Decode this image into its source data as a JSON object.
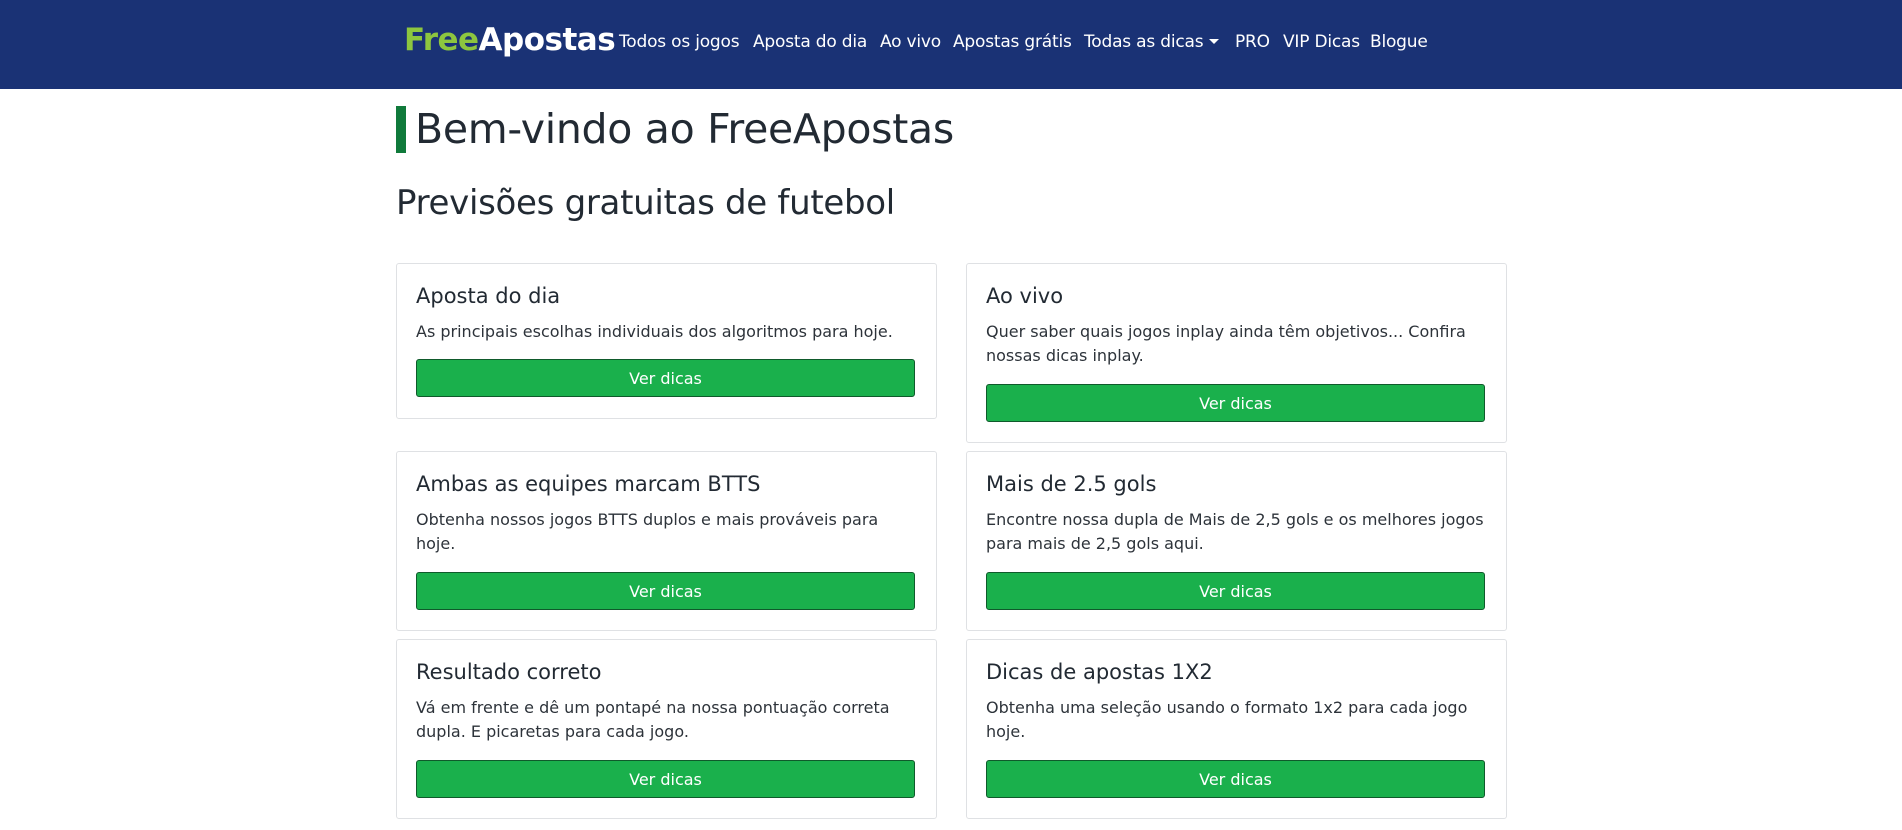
{
  "brand": {
    "part1": "Free",
    "part2": "Apostas"
  },
  "nav": {
    "items": [
      {
        "label": "Todos os jogos"
      },
      {
        "label": "Aposta do dia"
      },
      {
        "label": "Ao vivo"
      },
      {
        "label": "Apostas grátis"
      },
      {
        "label": "Todas as dicas"
      },
      {
        "label": "PRO"
      },
      {
        "label": "VIP Dicas"
      },
      {
        "label": "Blogue"
      }
    ]
  },
  "main": {
    "title": "Bem-vindo ao FreeApostas",
    "subtitle": "Previsões gratuitas de futebol"
  },
  "cards": [
    {
      "title": "Aposta do dia",
      "text": "As principais escolhas individuais dos algoritmos para hoje.",
      "button": "Ver dicas"
    },
    {
      "title": "Ao vivo",
      "text": "Quer saber quais jogos inplay ainda têm objetivos... Confira nossas dicas inplay.",
      "button": "Ver dicas"
    },
    {
      "title": "Ambas as equipes marcam BTTS",
      "text": "Obtenha nossos jogos BTTS duplos e mais prováveis para hoje.",
      "button": "Ver dicas"
    },
    {
      "title": "Mais de 2.5 gols",
      "text": "Encontre nossa dupla de Mais de 2,5 gols e os melhores jogos para mais de 2,5 gols aqui.",
      "button": "Ver dicas"
    },
    {
      "title": "Resultado correto",
      "text": "Vá em frente e dê um pontapé na nossa pontuação correta dupla. E picaretas para cada jogo.",
      "button": "Ver dicas"
    },
    {
      "title": "Dicas de apostas 1X2",
      "text": "Obtenha uma seleção usando o formato 1x2 para cada jogo hoje.",
      "button": "Ver dicas"
    }
  ],
  "colors": {
    "navbar": "#1a3275",
    "brand_accent": "#8dc63f",
    "button": "#1ab04c",
    "title_bar": "#107a3b"
  }
}
